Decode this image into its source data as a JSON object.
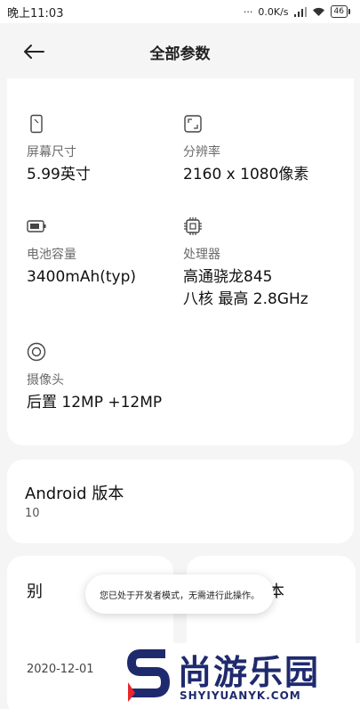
{
  "status_bar": {
    "time": "晚上11:03",
    "speed": "0.0K/s",
    "battery": "46"
  },
  "header": {
    "title": "全部参数"
  },
  "specs": [
    {
      "label": "屏幕尺寸",
      "value": "5.99英寸",
      "icon": "screen-icon"
    },
    {
      "label": "分辨率",
      "value": "2160 x 1080像素",
      "icon": "resolution-icon"
    },
    {
      "label": "电池容量",
      "value": "3400mAh(typ)",
      "icon": "battery-icon"
    },
    {
      "label": "处理器",
      "value_line1": "高通骁龙845",
      "value_line2": "八核 最高 2.8GHz",
      "icon": "chip-icon"
    },
    {
      "label": "摄像头",
      "value": "后置 12MP +12MP",
      "icon": "camera-icon"
    }
  ],
  "android": {
    "title": "Android 版本",
    "value": "10"
  },
  "bottom_left": {
    "title": "别",
    "date": "2020-12-01"
  },
  "bottom_right": {
    "title": "本"
  },
  "toast": {
    "text": "您已处于开发者模式，无需进行此操作。"
  },
  "watermark": {
    "cn": "尚游乐园",
    "en": "SHYIYUANYK.COM"
  },
  "colors": {
    "background": "#f5f5f5",
    "card": "#ffffff",
    "watermark": "#1f2a6e",
    "watermark_accent": "#e8262d"
  }
}
